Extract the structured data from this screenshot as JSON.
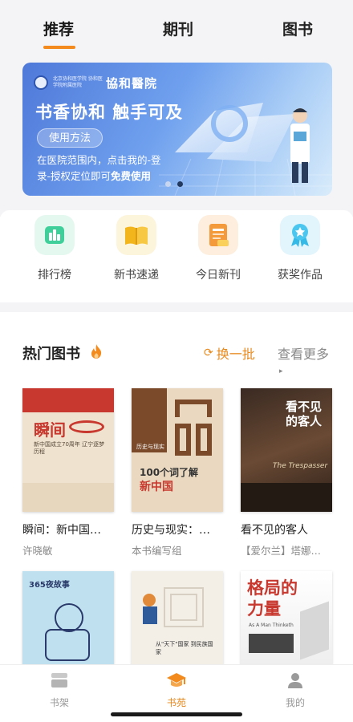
{
  "tabs": [
    {
      "label": "推荐",
      "active": true
    },
    {
      "label": "期刊",
      "active": false
    },
    {
      "label": "图书",
      "active": false
    }
  ],
  "banner": {
    "logo_small": "北京协和医学院 协和医学院附属医院",
    "logo_name": "協和醫院",
    "headline": "书香协和 触手可及",
    "pill": "使用方法",
    "desc_line1": "在医院范围内，点击我的-登",
    "desc_line2": "录-授权定位即可",
    "desc_bold": "免费使用",
    "page_index": 1,
    "page_count": 2
  },
  "quick_actions": [
    {
      "label": "排行榜",
      "icon": "ranking-icon",
      "color": "#3fcf9a"
    },
    {
      "label": "新书速递",
      "icon": "open-book-icon",
      "color": "#f2b51b"
    },
    {
      "label": "今日新刊",
      "icon": "new-journal-icon",
      "color": "#f59a3a"
    },
    {
      "label": "获奖作品",
      "icon": "award-medal-icon",
      "color": "#35b9e6"
    }
  ],
  "hot_books": {
    "title": "热门图书",
    "refresh_label": "换一批",
    "more_label": "查看更多",
    "items": [
      {
        "title": "瞬间：新中国…",
        "author": "许晓敏",
        "cover_title": "瞬间",
        "cover_sub": "新中国成立70周年 辽宁逐梦历程"
      },
      {
        "title": "历史与现实：…",
        "author": "本书编写组",
        "cover_title": "100个词了解",
        "cover_sub": "新中国",
        "cover_top": "历史与现实"
      },
      {
        "title": "看不见的客人",
        "author": "【爱尔兰】塔娜…",
        "cover_title": "看不见的客人",
        "cover_sub": "The Trespasser"
      },
      {
        "title": "",
        "author": "",
        "cover_title": "365夜故事"
      },
      {
        "title": "",
        "author": "",
        "cover_title": "从\"天下\"国家 到民族国家"
      },
      {
        "title": "",
        "author": "",
        "cover_title": "格局的力量",
        "cover_sub": "As A Man Thinketh"
      }
    ]
  },
  "accent": "#f28a1e",
  "bottom_nav": [
    {
      "label": "书架",
      "icon": "bookshelf-icon",
      "active": false
    },
    {
      "label": "书苑",
      "icon": "graduation-cap-icon",
      "active": true
    },
    {
      "label": "我的",
      "icon": "person-icon",
      "active": false
    }
  ]
}
